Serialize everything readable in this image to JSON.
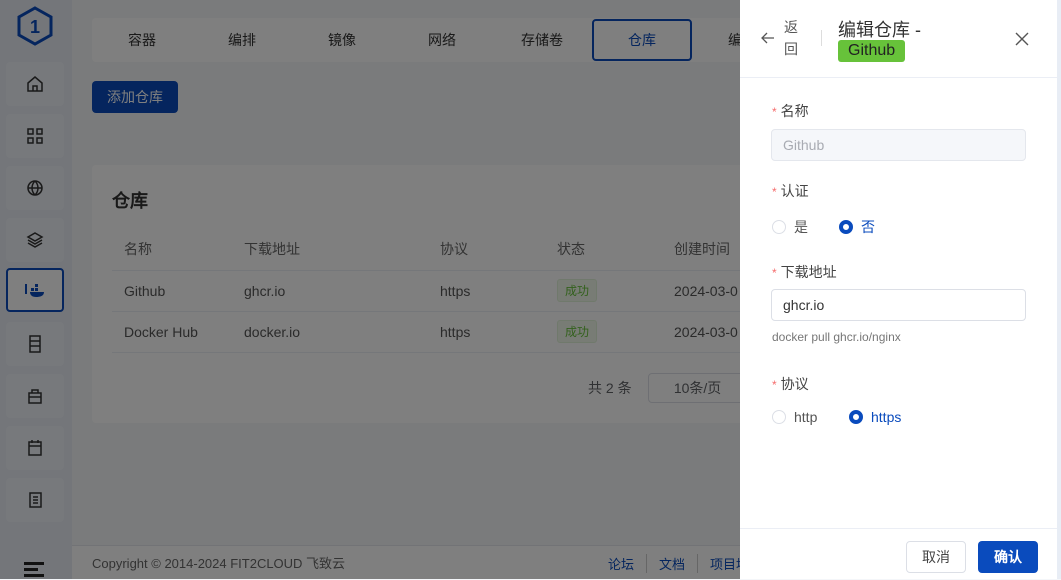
{
  "sidebar": {
    "items": [
      "home",
      "apps",
      "website",
      "layers",
      "containers",
      "database",
      "toolbox",
      "cronjob",
      "logs"
    ]
  },
  "tabs": [
    "容器",
    "编排",
    "镜像",
    "网络",
    "存储卷",
    "仓库",
    "编排"
  ],
  "add_button": "添加仓库",
  "card": {
    "title": "仓库",
    "columns": [
      "名称",
      "下载地址",
      "协议",
      "状态",
      "创建时间"
    ],
    "rows": [
      {
        "name": "Github",
        "url": "ghcr.io",
        "protocol": "https",
        "status": "成功",
        "created": "2024-03-0"
      },
      {
        "name": "Docker Hub",
        "url": "docker.io",
        "protocol": "https",
        "status": "成功",
        "created": "2024-03-0"
      }
    ],
    "total": "共 2 条",
    "page_size": "10条/页"
  },
  "footer": {
    "copyright": "Copyright © 2014-2024 FIT2CLOUD 飞致云",
    "links": [
      "论坛",
      "文档",
      "项目地"
    ]
  },
  "drawer": {
    "back": "返回",
    "back_chars": [
      "返",
      "回"
    ],
    "title": "编辑仓库 -",
    "tag": "Github",
    "name_label": "名称",
    "name_value": "Github",
    "auth_label": "认证",
    "auth_options": [
      "是",
      "否"
    ],
    "url_label": "下载地址",
    "url_value": "ghcr.io",
    "url_hint": "docker pull ghcr.io/nginx",
    "protocol_label": "协议",
    "protocol_options": [
      "http",
      "https"
    ],
    "cancel": "取消",
    "confirm": "确认"
  }
}
